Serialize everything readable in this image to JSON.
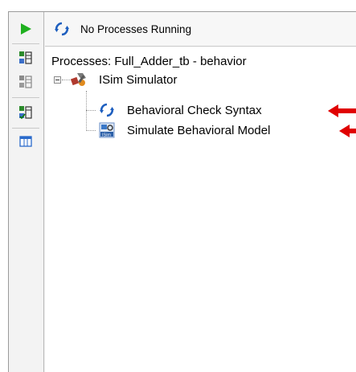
{
  "toolbar": {
    "run_icon": "run-play-icon",
    "buttons": [
      "implement-top-module-icon",
      "rerun-icon",
      "rerun-all-icon",
      "panel-view-icon"
    ]
  },
  "header": {
    "status_icon": "refresh-icon",
    "status_text": "No Processes Running"
  },
  "processes": {
    "title": "Processes: Full_Adder_tb - behavior",
    "root": {
      "label": "ISim Simulator",
      "icon": "isim-simulator-icon",
      "expanded": true
    },
    "children": [
      {
        "label": "Behavioral Check Syntax",
        "icon": "refresh-icon"
      },
      {
        "label": "Simulate Behavioral Model",
        "icon": "isim-icon"
      }
    ]
  },
  "annotation": {
    "arrow_color": "#e00000"
  }
}
